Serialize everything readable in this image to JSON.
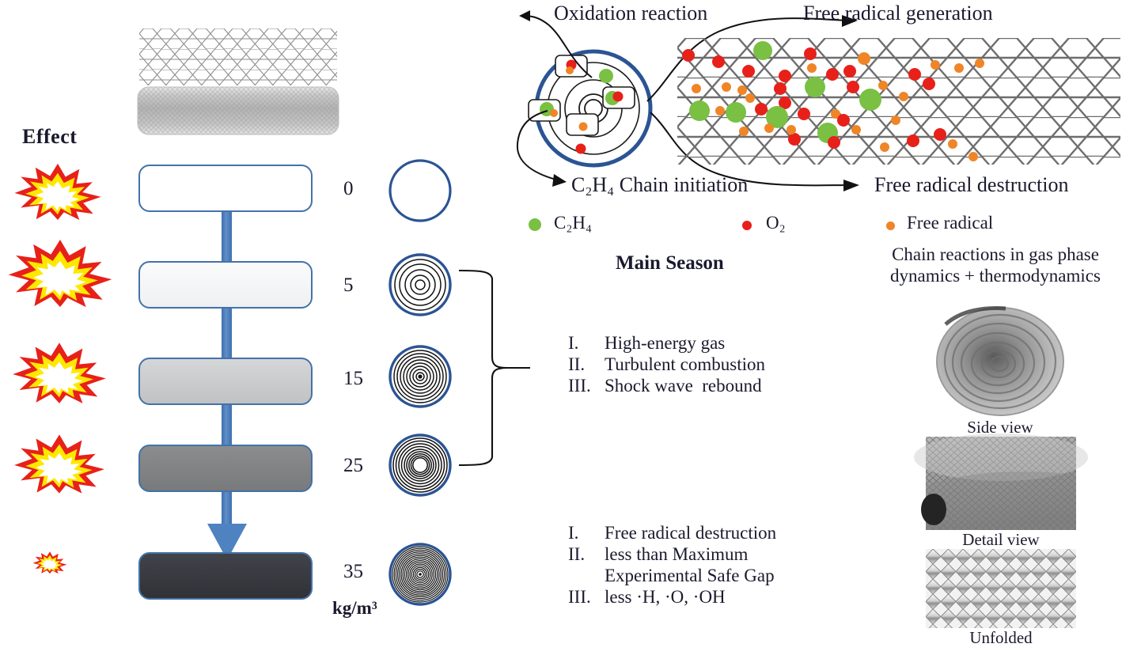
{
  "left_panel": {
    "effect_header": "Effect",
    "unit_label": "kg/m³",
    "rows": [
      {
        "density": "0",
        "fill": "#ffffff",
        "rings": 0,
        "blast": "none"
      },
      {
        "density": "5",
        "fill": "#f2f3f5",
        "rings": 4,
        "blast": "large"
      },
      {
        "density": "15",
        "fill": "#c8c9cb",
        "rings": 7,
        "blast": "medium"
      },
      {
        "density": "25",
        "fill": "#808284",
        "rings": 9,
        "blast": "medium"
      },
      {
        "density": "35",
        "fill": "#35373d",
        "rings": 16,
        "blast": "tiny"
      }
    ],
    "arrow_color": "#4472a8",
    "box_border_color": "#4472a8",
    "circle_ring_color": "#2b5494"
  },
  "mechanism": {
    "labels": {
      "oxidation_reaction": "Oxidation reaction",
      "chain_initiation": "C₂H₄ Chain initiation",
      "free_radical_generation": "Free radical generation",
      "free_radical_destruction": "Free radical destruction"
    },
    "ring_color": "#2b5494",
    "mesh_color": "#6e6e6e"
  },
  "legend": {
    "items": [
      {
        "label": "C₂H₄",
        "color": "#79c043",
        "size": 14
      },
      {
        "label": "O₂",
        "color": "#e8201a",
        "size": 11
      },
      {
        "label": "Free radical",
        "color": "#ef8527",
        "size": 10
      }
    ]
  },
  "main_section": {
    "title": "Main Season",
    "list_a": [
      {
        "num": "I.",
        "text": "High-energy gas"
      },
      {
        "num": "II.",
        "text": "Turbulent combustion"
      },
      {
        "num": "III.",
        "text": "Shock wave  rebound"
      }
    ],
    "list_b": [
      {
        "num": "I.",
        "text": "Free radical destruction"
      },
      {
        "num": "II.",
        "text": "less than Maximum"
      },
      {
        "num": "",
        "text": "Experimental Safe Gap"
      },
      {
        "num": "III.",
        "text": "less ·H, ·O, ·OH"
      }
    ]
  },
  "right_panel": {
    "chain_reactions_line1": "Chain reactions in gas phase",
    "chain_reactions_line2": "dynamics + thermodynamics",
    "captions": {
      "side_view": "Side view",
      "detail_view": "Detail view",
      "unfolded": "Unfolded"
    }
  }
}
